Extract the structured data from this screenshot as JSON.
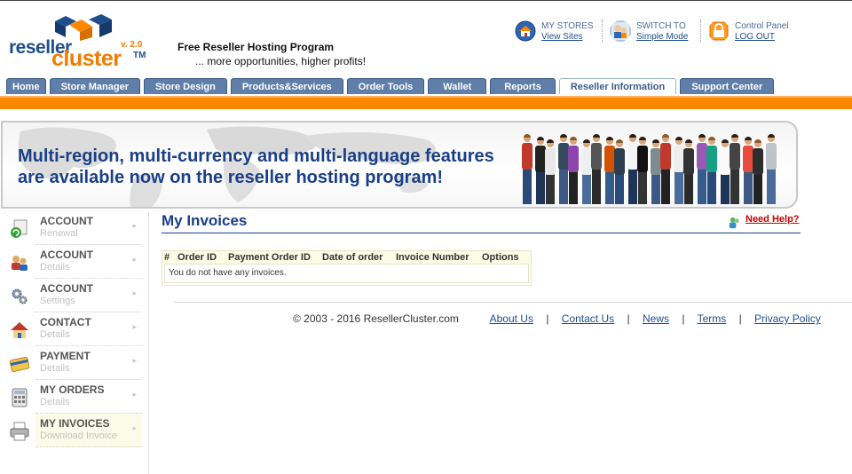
{
  "brand": {
    "logo_line1": "reseller",
    "logo_line2": "cluster",
    "trademark": "TM",
    "version": "v. 2.0",
    "tagline_title": "Free Reseller Hosting Program",
    "tagline_sub": "... more opportunities, higher profits!"
  },
  "top_links": [
    {
      "label": "MY STORES",
      "link": "View Sites",
      "icon": "house-globe-icon"
    },
    {
      "label": "SWITCH TO",
      "link": "Simple Mode",
      "icon": "user-switch-icon"
    },
    {
      "label": "Control Panel",
      "link": "LOG OUT",
      "icon": "lock-icon"
    }
  ],
  "tabs": [
    {
      "label": "Home",
      "active": false
    },
    {
      "label": "Store Manager",
      "active": false
    },
    {
      "label": "Store Design",
      "active": false
    },
    {
      "label": "Products&Services",
      "active": false
    },
    {
      "label": "Order Tools",
      "active": false
    },
    {
      "label": "Wallet",
      "active": false
    },
    {
      "label": "Reports",
      "active": false
    },
    {
      "label": "Reseller Information",
      "active": true
    },
    {
      "label": "Support Center",
      "active": false
    }
  ],
  "banner": {
    "line1": "Multi-region, multi-currency and multi-language features",
    "line2": "are available now on the reseller hosting program!"
  },
  "sidebar": {
    "items": [
      {
        "title": "ACCOUNT",
        "subtitle": "Renewal",
        "icon": "renewal-icon",
        "active": false
      },
      {
        "title": "ACCOUNT",
        "subtitle": "Details",
        "icon": "users-icon",
        "active": false
      },
      {
        "title": "ACCOUNT",
        "subtitle": "Settings",
        "icon": "gears-icon",
        "active": false
      },
      {
        "title": "CONTACT",
        "subtitle": "Details",
        "icon": "house-icon",
        "active": false
      },
      {
        "title": "PAYMENT",
        "subtitle": "Details",
        "icon": "credit-card-icon",
        "active": false
      },
      {
        "title": "MY ORDERS",
        "subtitle": "Details",
        "icon": "calculator-icon",
        "active": false
      },
      {
        "title": "MY INVOICES",
        "subtitle": "Download Invoice",
        "icon": "printer-icon",
        "active": true
      }
    ]
  },
  "main": {
    "title": "My Invoices",
    "help_link": "Need Help?",
    "table": {
      "columns": [
        "#",
        "Order ID",
        "Payment Order ID",
        "Date of order",
        "Invoice Number",
        "Options"
      ],
      "empty_message": "You do not have any invoices."
    }
  },
  "footer": {
    "copyright": "© 2003 - 2016 ResellerCluster.com",
    "links": [
      "About Us",
      "Contact Us",
      "News",
      "Terms",
      "Privacy Policy"
    ],
    "separator": "|"
  },
  "colors": {
    "brand_blue": "#1a3f86",
    "brand_orange": "#ff8800",
    "tab_blue": "#5f7ea8",
    "help_red": "#cc0000"
  }
}
